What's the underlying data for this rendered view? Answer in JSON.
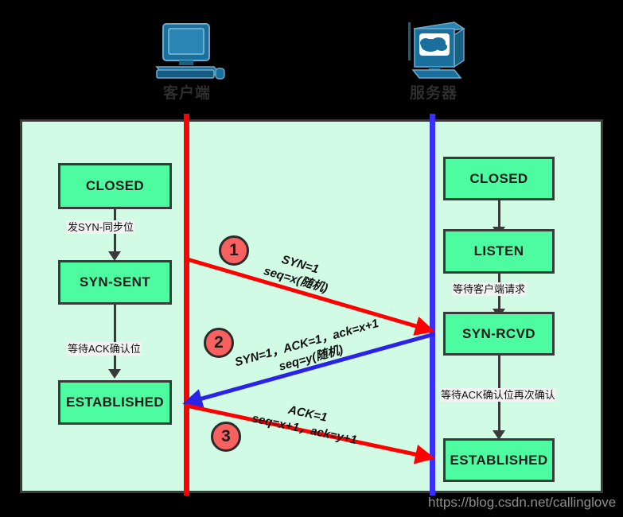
{
  "endpoints": {
    "client": {
      "label": "客户端",
      "icon": "desktop-computer-icon",
      "lifeline_color": "#ff0000"
    },
    "server": {
      "label": "服务器",
      "icon": "server-cloud-monitor-icon",
      "lifeline_color": "#3a30f5"
    }
  },
  "panel": {
    "background": "#d2fbe6",
    "border_color": "#3a3a3a"
  },
  "client_states": [
    {
      "name": "CLOSED"
    },
    {
      "name": "SYN-SENT"
    },
    {
      "name": "ESTABLISHED"
    }
  ],
  "client_transitions": [
    {
      "label": "发SYN-同步位"
    },
    {
      "label": "等待ACK确认位"
    }
  ],
  "server_states": [
    {
      "name": "CLOSED"
    },
    {
      "name": "LISTEN"
    },
    {
      "name": "SYN-RCVD"
    },
    {
      "name": "ESTABLISHED"
    }
  ],
  "server_transitions": [
    {
      "label": ""
    },
    {
      "label": "等待客户端请求"
    },
    {
      "label": "等待ACK确认位再次确认"
    }
  ],
  "messages": [
    {
      "step": "1",
      "direction": "client-to-server",
      "color": "#ff0000",
      "line1": "SYN=1",
      "line2": "seq=x(随机)"
    },
    {
      "step": "2",
      "direction": "server-to-client",
      "color": "#2b22e8",
      "line1": "SYN=1，ACK=1，ack=x+1",
      "line2": "seq=y(随机)"
    },
    {
      "step": "3",
      "direction": "client-to-server",
      "color": "#ff0000",
      "line1": "ACK=1",
      "line2": "seq=x+1，ack=y+1"
    }
  ],
  "watermark": {
    "text": "https://blog.csdn.net/callinglove",
    "color": "#8d8d8d"
  },
  "colors": {
    "state_box_fill": "#4dfca0",
    "step_circle_fill": "#f8615f",
    "icon_blue": "#1b6f9c"
  }
}
